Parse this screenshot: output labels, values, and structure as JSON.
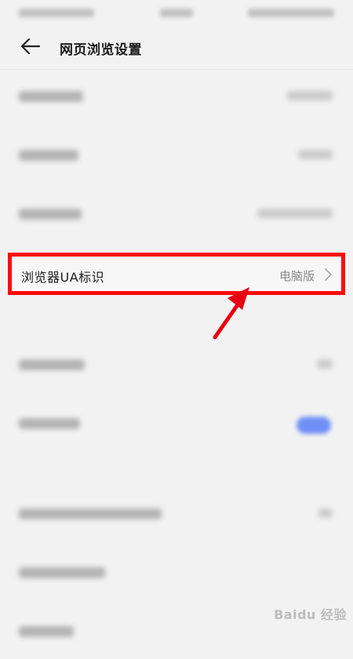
{
  "header": {
    "title": "网页浏览设置",
    "back_icon": "back-arrow-icon"
  },
  "highlighted_row": {
    "label": "浏览器UA标识",
    "value": "电脑版",
    "chevron_icon": "chevron-right-icon"
  },
  "annotation": {
    "box_color": "#ff0a0a",
    "arrow_color": "#e60012"
  },
  "toggle": {
    "color": "#6f8ff5"
  },
  "watermark": {
    "text": "Baidu 经验"
  }
}
